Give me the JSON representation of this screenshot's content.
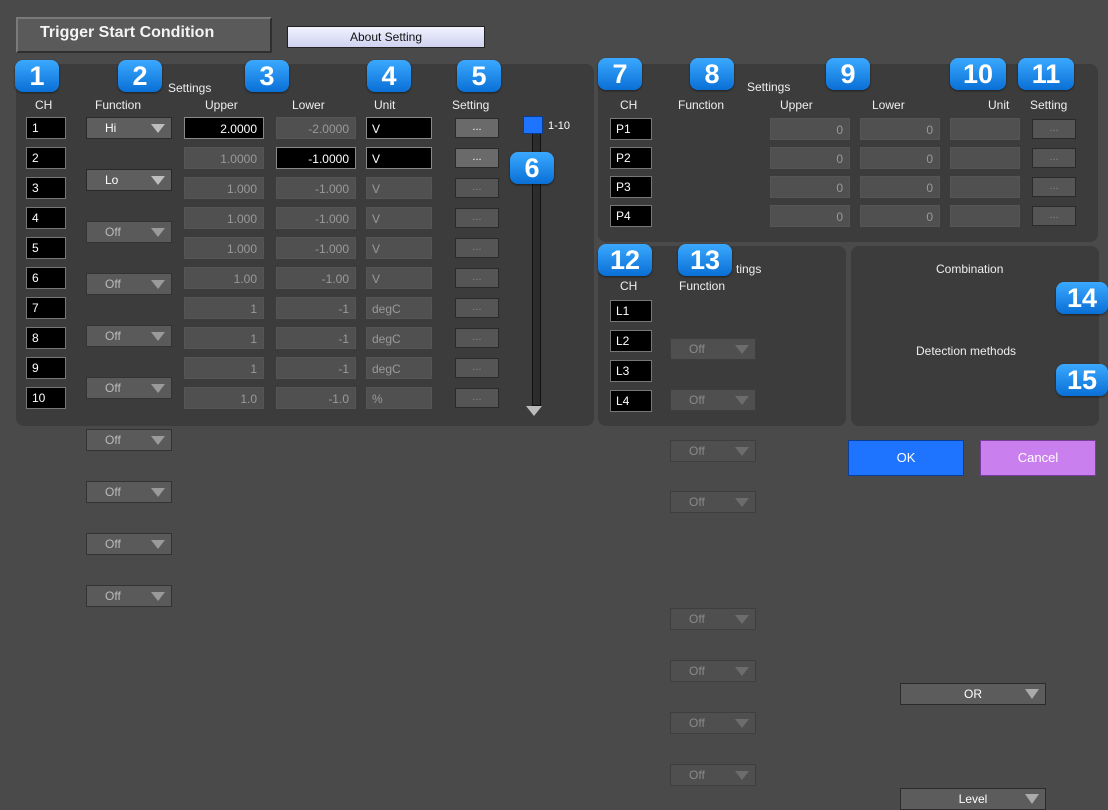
{
  "title": "Trigger Start Condition",
  "about_setting": "About Setting",
  "analog_panel": {
    "heading": "Settings",
    "headers": {
      "ch": "CH",
      "function": "Function",
      "upper": "Upper",
      "lower": "Lower",
      "unit": "Unit",
      "setting": "Setting"
    },
    "rows": [
      {
        "ch": "1",
        "function": "Hi",
        "upper": "2.0000",
        "lower": "-2.0000",
        "unit": "V",
        "active": true
      },
      {
        "ch": "2",
        "function": "Lo",
        "upper": "1.0000",
        "lower": "-1.0000",
        "unit": "V",
        "active": true
      },
      {
        "ch": "3",
        "function": "Off",
        "upper": "1.000",
        "lower": "-1.000",
        "unit": "V",
        "active": false
      },
      {
        "ch": "4",
        "function": "Off",
        "upper": "1.000",
        "lower": "-1.000",
        "unit": "V",
        "active": false
      },
      {
        "ch": "5",
        "function": "Off",
        "upper": "1.000",
        "lower": "-1.000",
        "unit": "V",
        "active": false
      },
      {
        "ch": "6",
        "function": "Off",
        "upper": "1.00",
        "lower": "-1.00",
        "unit": "V",
        "active": false
      },
      {
        "ch": "7",
        "function": "Off",
        "upper": "1",
        "lower": "-1",
        "unit": "degC",
        "active": false
      },
      {
        "ch": "8",
        "function": "Off",
        "upper": "1",
        "lower": "-1",
        "unit": "degC",
        "active": false
      },
      {
        "ch": "9",
        "function": "Off",
        "upper": "1",
        "lower": "-1",
        "unit": "degC",
        "active": false
      },
      {
        "ch": "10",
        "function": "Off",
        "upper": "1.0",
        "lower": "-1.0",
        "unit": "%",
        "active": false
      }
    ],
    "setting_label": "...",
    "scroll_label": "1-10"
  },
  "pulse_panel": {
    "heading": "Settings",
    "headers": {
      "ch": "CH",
      "function": "Function",
      "upper": "Upper",
      "lower": "Lower",
      "unit": "Unit",
      "setting": "Setting"
    },
    "rows": [
      {
        "ch": "P1",
        "function": "Off",
        "upper": "0",
        "lower": "0"
      },
      {
        "ch": "P2",
        "function": "Off",
        "upper": "0",
        "lower": "0"
      },
      {
        "ch": "P3",
        "function": "Off",
        "upper": "0",
        "lower": "0"
      },
      {
        "ch": "P4",
        "function": "Off",
        "upper": "0",
        "lower": "0"
      }
    ],
    "setting_label": "..."
  },
  "logic_panel": {
    "heading": "tings",
    "headers": {
      "ch": "CH",
      "function": "Function"
    },
    "rows": [
      {
        "ch": "L1",
        "function": "Off"
      },
      {
        "ch": "L2",
        "function": "Off"
      },
      {
        "ch": "L3",
        "function": "Off"
      },
      {
        "ch": "L4",
        "function": "Off"
      }
    ]
  },
  "combination": {
    "label": "Combination",
    "value": "OR"
  },
  "detection": {
    "label": "Detection methods",
    "value": "Level"
  },
  "ok": "OK",
  "cancel": "Cancel",
  "badges": [
    "1",
    "2",
    "3",
    "4",
    "5",
    "6",
    "7",
    "8",
    "9",
    "10",
    "11",
    "12",
    "13",
    "14",
    "15"
  ],
  "colors": {
    "badge": "#1a8cf0",
    "ok": "#1e73ff",
    "cancel": "#c980ee"
  }
}
